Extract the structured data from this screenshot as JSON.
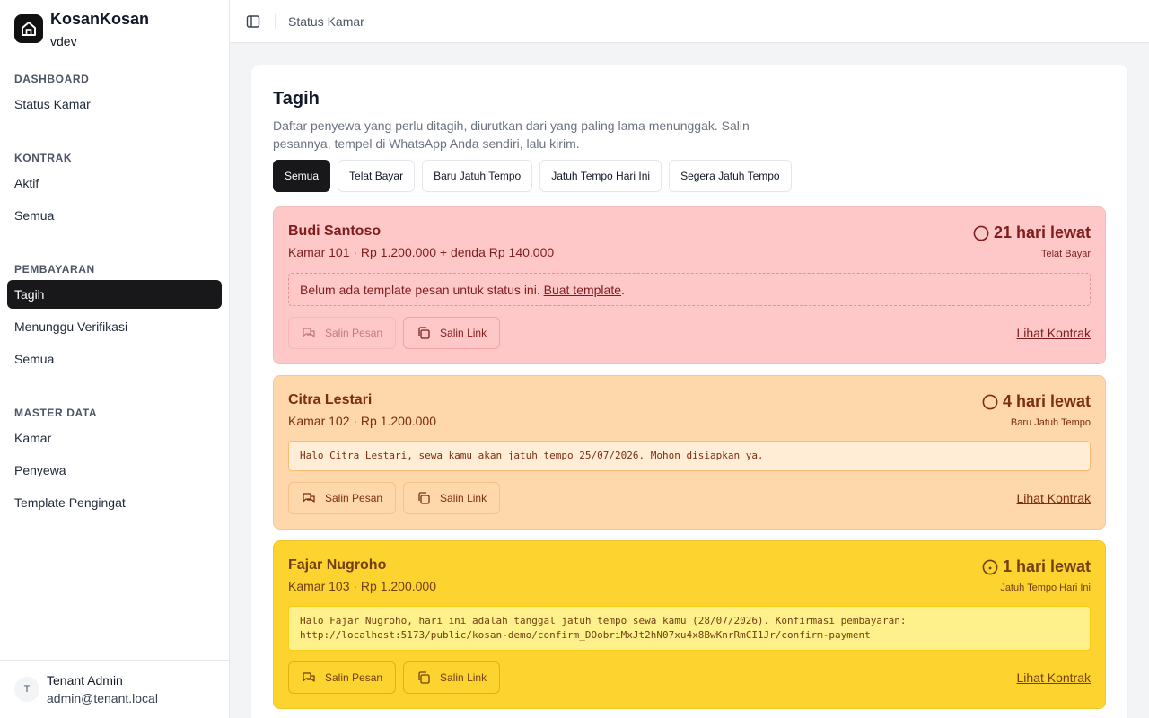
{
  "brand": {
    "name": "KosanKosan",
    "sub": "vdev",
    "icon": "home-icon"
  },
  "sidebar": {
    "sections": [
      {
        "heading": "DASHBOARD",
        "items": [
          "Status Kamar"
        ]
      },
      {
        "heading": "KONTRAK",
        "items": [
          "Aktif",
          "Semua"
        ]
      },
      {
        "heading": "PEMBAYARAN",
        "items": [
          "Tagih",
          "Menunggu Verifikasi",
          "Semua"
        ],
        "active": "Tagih"
      },
      {
        "heading": "MASTER DATA",
        "items": [
          "Kamar",
          "Penyewa",
          "Template Pengingat"
        ]
      }
    ]
  },
  "user": {
    "initial": "T",
    "name": "Tenant Admin",
    "email": "admin@tenant.local"
  },
  "header": {
    "crumb": "Status Kamar",
    "toggle_icon": "sidebar-toggle-icon"
  },
  "page": {
    "title": "Tagih",
    "description": "Daftar penyewa yang perlu ditagih, diurutkan dari yang paling lama menunggak. Salin pesannya, tempel di WhatsApp Anda sendiri, lalu kirim."
  },
  "filters": [
    "Semua",
    "Telat Bayar",
    "Baru Jatuh Tempo",
    "Jatuh Tempo Hari Ini",
    "Segera Jatuh Tempo"
  ],
  "active_filter": "Semua",
  "tenants": [
    {
      "name": "Budi Santoso",
      "info": "Kamar 101 · Rp 1.200.000 + denda Rp 140.000",
      "overdue": "21 hari lewat",
      "status": "Telat Bayar",
      "notice_text": "Belum ada template pesan untuk status ini.",
      "notice_link": "Buat template",
      "notice_suffix": ".",
      "copy_message": "Salin Pesan",
      "copy_link": "Salin Link",
      "contract": "Lihat Kontrak",
      "color": "#fec8c8"
    },
    {
      "name": "Citra Lestari",
      "info": "Kamar 102 · Rp 1.200.000",
      "overdue": "4 hari lewat",
      "status": "Baru Jatuh Tempo",
      "message": "Halo Citra Lestari, sewa kamu akan jatuh tempo 25/07/2026. Mohon disiapkan ya.",
      "copy_message": "Salin Pesan",
      "copy_link": "Salin Link",
      "contract": "Lihat Kontrak",
      "color": "#fed7aa"
    },
    {
      "name": "Fajar Nugroho",
      "info": "Kamar 103 · Rp 1.200.000",
      "overdue": "1 hari lewat",
      "status": "Jatuh Tempo Hari Ini",
      "message_line1": "Halo Fajar Nugroho, hari ini adalah tanggal jatuh tempo sewa kamu (28/07/2026). Konfirmasi pembayaran:",
      "message_line2": "http://localhost:5173/public/kosan-demo/confirm_DOobriMxJt2hN07xu4x8BwKnrRmCI1Jr/confirm-payment",
      "copy_message": "Salin Pesan",
      "copy_link": "Salin Link",
      "contract": "Lihat Kontrak",
      "color": "#fdd32f"
    }
  ]
}
